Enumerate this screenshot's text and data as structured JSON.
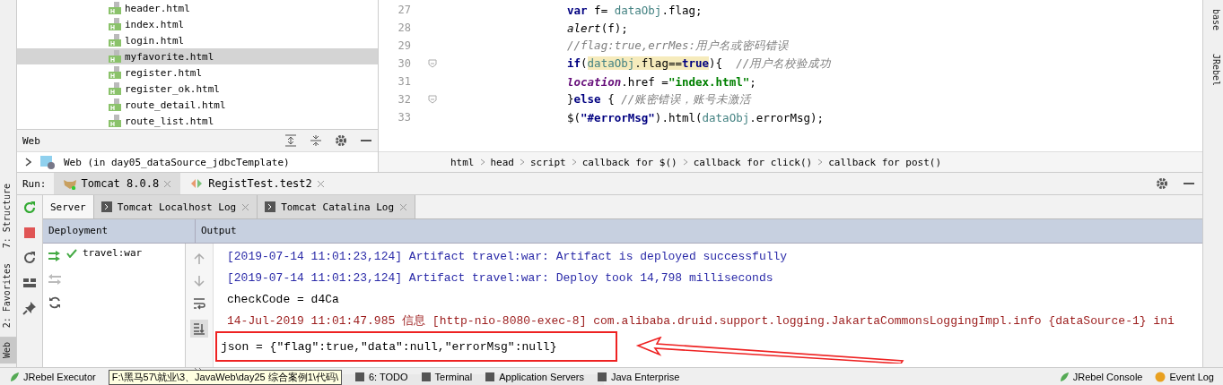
{
  "left_strip": {
    "items": [
      {
        "label": "7: Structure",
        "selected": false
      },
      {
        "label": "2: Favorites",
        "selected": false
      },
      {
        "label": "Web",
        "selected": true
      }
    ]
  },
  "right_strip": {
    "items": [
      "base",
      "JRebel"
    ]
  },
  "project_tree": {
    "files": [
      {
        "name": "header.html",
        "selected": false
      },
      {
        "name": "index.html",
        "selected": false
      },
      {
        "name": "login.html",
        "selected": false
      },
      {
        "name": "myfavorite.html",
        "selected": true
      },
      {
        "name": "register.html",
        "selected": false
      },
      {
        "name": "register_ok.html",
        "selected": false
      },
      {
        "name": "route_detail.html",
        "selected": false
      },
      {
        "name": "route_list.html",
        "selected": false
      }
    ]
  },
  "web_panel": {
    "title": "Web",
    "items": [
      {
        "label": "Web (in day05_dataSource_jdbcTemplate)",
        "expanded": false
      }
    ]
  },
  "editor": {
    "lines": [
      {
        "number": "27",
        "fold": false,
        "tokens": [
          {
            "text": "var",
            "kind": "keyword"
          },
          {
            "text": " f= ",
            "kind": "plain"
          },
          {
            "text": "dataObj",
            "kind": "var"
          },
          {
            "text": ".flag;",
            "kind": "plain"
          }
        ]
      },
      {
        "number": "28",
        "fold": false,
        "tokens": [
          {
            "text": "alert",
            "kind": "italic"
          },
          {
            "text": "(f);",
            "kind": "plain"
          }
        ]
      },
      {
        "number": "29",
        "fold": false,
        "tokens": [
          {
            "text": "//flag:true,errMes:用户名或密码错误",
            "kind": "comment"
          }
        ]
      },
      {
        "number": "30",
        "fold": true,
        "tokens": [
          {
            "text": "if",
            "kind": "keyword"
          },
          {
            "text": "(",
            "kind": "plain"
          },
          {
            "text": "dataObj",
            "kind": "var_hl"
          },
          {
            "text": ".flag==",
            "kind": "plain_hl"
          },
          {
            "text": "true",
            "kind": "keyword_hl"
          },
          {
            "text": "){  ",
            "kind": "plain"
          },
          {
            "text": "//用户名校验成功",
            "kind": "comment"
          }
        ]
      },
      {
        "number": "31",
        "fold": false,
        "tokens": [
          {
            "text": "location",
            "kind": "global"
          },
          {
            "text": ".href =",
            "kind": "plain"
          },
          {
            "text": "\"index.html\"",
            "kind": "string"
          },
          {
            "text": ";",
            "kind": "plain"
          }
        ]
      },
      {
        "number": "32",
        "fold": true,
        "tokens": [
          {
            "text": "}",
            "kind": "plain"
          },
          {
            "text": "else",
            "kind": "keyword"
          },
          {
            "text": " { ",
            "kind": "plain"
          },
          {
            "text": "//账密错误，账号未激活",
            "kind": "comment"
          }
        ]
      },
      {
        "number": "33",
        "fold": false,
        "tokens": [
          {
            "text": "$(",
            "kind": "plain"
          },
          {
            "text": "\"#errorMsg\"",
            "kind": "selector"
          },
          {
            "text": ").html(",
            "kind": "plain"
          },
          {
            "text": "dataObj",
            "kind": "var"
          },
          {
            "text": ".errorMsg);",
            "kind": "plain"
          }
        ]
      }
    ],
    "breadcrumbs": [
      "html",
      "head",
      "script",
      "callback for $()",
      "callback for click()",
      "callback for post()"
    ]
  },
  "run": {
    "label": "Run:",
    "tabs": [
      {
        "label": "Tomcat 8.0.8",
        "selected": true
      },
      {
        "label": "RegistTest.test2",
        "selected": false
      }
    ],
    "sub_tabs": [
      {
        "label": "Server",
        "selected": true,
        "closable": false
      },
      {
        "label": "Tomcat Localhost Log",
        "selected": false,
        "closable": true
      },
      {
        "label": "Tomcat Catalina Log",
        "selected": false,
        "closable": true
      }
    ],
    "deployment": {
      "title": "Deployment",
      "items": [
        {
          "label": "travel:war",
          "deployed": true
        }
      ]
    },
    "output": {
      "title": "Output",
      "lines": [
        {
          "text": "[2019-07-14 11:01:23,124] Artifact travel:war: Artifact is deployed successfully",
          "kind": "server",
          "boxed": false
        },
        {
          "text": "[2019-07-14 11:01:23,124] Artifact travel:war: Deploy took 14,798 milliseconds",
          "kind": "server",
          "boxed": false
        },
        {
          "text": "checkCode = d4Ca",
          "kind": "stdout",
          "boxed": false
        },
        {
          "text": "14-Jul-2019 11:01:47.985 信息 [http-nio-8080-exec-8] com.alibaba.druid.support.logging.JakartaCommonsLoggingImpl.info {dataSource-1} ini",
          "kind": "log",
          "boxed": false
        },
        {
          "text": "json = {\"flag\":true,\"data\":null,\"errorMsg\":null}",
          "kind": "stdout",
          "boxed": true
        }
      ]
    }
  },
  "status_bar": {
    "tooltip": "F:\\黑马57\\就业\\3、JavaWeb\\day25 综合案例1\\代码\\",
    "left_items": [
      "JRebel Executor",
      "6: TODO",
      "Terminal",
      "Application Servers",
      "Java Enterprise"
    ],
    "right_items": [
      "JRebel Console",
      "Event Log"
    ]
  }
}
